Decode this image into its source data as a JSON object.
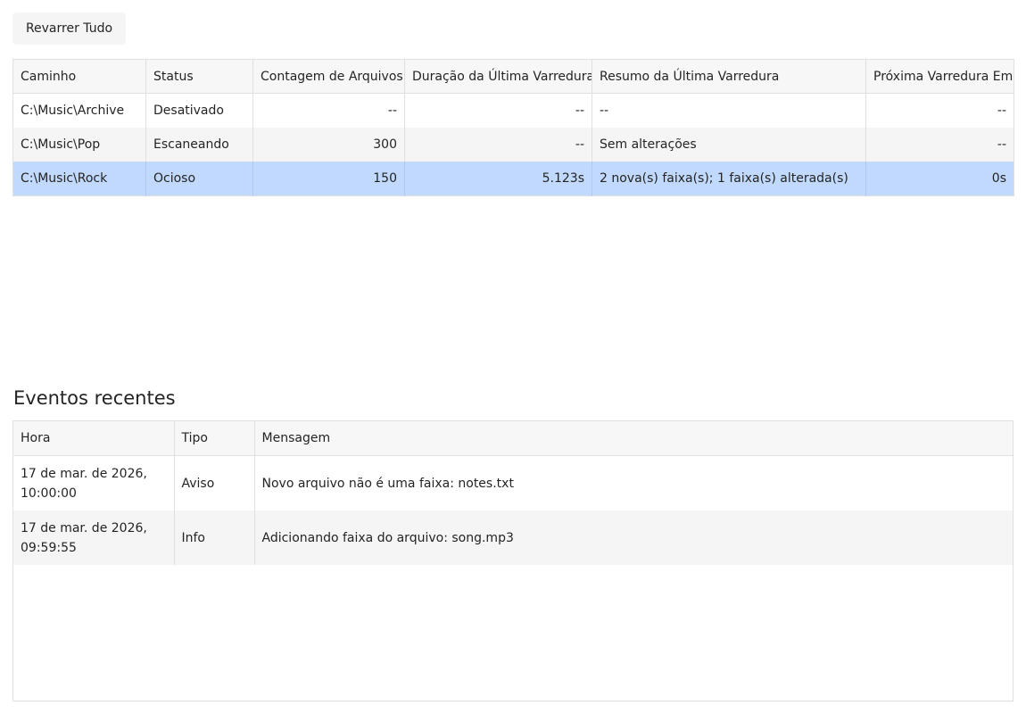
{
  "toolbar": {
    "rescan_all_label": "Revarrer Tudo"
  },
  "folders_table": {
    "headers": {
      "path": "Caminho",
      "status": "Status",
      "file_count": "Contagem de Arquivos",
      "last_scan_duration": "Duração da Última Varredura",
      "last_scan_summary": "Resumo da Última Varredura",
      "next_scan_in": "Próxima Varredura Em"
    },
    "rows": [
      {
        "path": "C:\\Music\\Archive",
        "status": "Desativado",
        "file_count": "--",
        "last_scan_duration": "--",
        "last_scan_summary": "--",
        "next_scan_in": "--"
      },
      {
        "path": "C:\\Music\\Pop",
        "status": "Escaneando",
        "file_count": "300",
        "last_scan_duration": "--",
        "last_scan_summary": "Sem alterações",
        "next_scan_in": "--"
      },
      {
        "path": "C:\\Music\\Rock",
        "status": "Ocioso",
        "file_count": "150",
        "last_scan_duration": "5.123s",
        "last_scan_summary": "2 nova(s) faixa(s); 1 faixa(s) alterada(s)",
        "next_scan_in": "0s"
      }
    ]
  },
  "events": {
    "title": "Eventos recentes",
    "headers": {
      "time": "Hora",
      "type": "Tipo",
      "message": "Mensagem"
    },
    "rows": [
      {
        "time": "17 de mar. de 2026, 10:00:00",
        "type": "Aviso",
        "message": "Novo arquivo não é uma faixa: notes.txt"
      },
      {
        "time": "17 de mar. de 2026, 09:59:55",
        "type": "Info",
        "message": "Adicionando faixa do arquivo: song.mp3"
      }
    ]
  },
  "colors": {
    "selected_row": "#c0d9fc",
    "header_bg": "#f7f7f8",
    "alt_row": "#f5f5f5",
    "border": "#e0e0e0"
  }
}
